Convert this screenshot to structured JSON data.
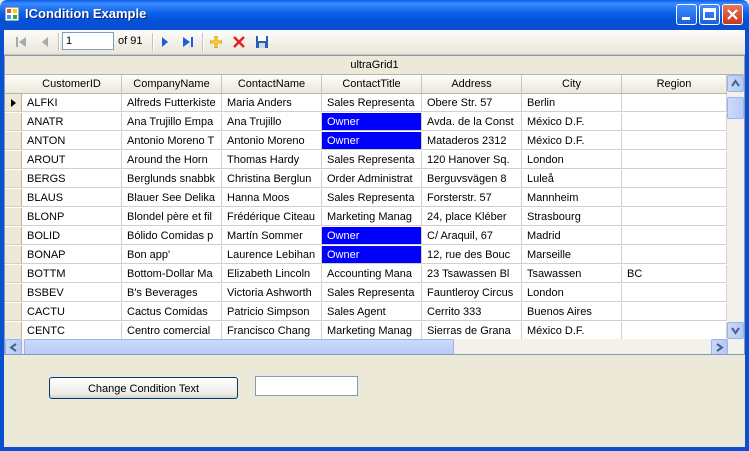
{
  "window": {
    "title": "ICondition Example"
  },
  "navigator": {
    "position": "1",
    "count_label": "of 91"
  },
  "grid": {
    "caption": "ultraGrid1",
    "columns": [
      "CustomerID",
      "CompanyName",
      "ContactName",
      "ContactTitle",
      "Address",
      "City",
      "Region"
    ],
    "rows": [
      [
        "ALFKI",
        "Alfreds Futterkiste",
        "Maria Anders",
        "Sales Representa",
        "Obere Str. 57",
        "Berlin",
        ""
      ],
      [
        "ANATR",
        "Ana Trujillo Empa",
        "Ana Trujillo",
        "Owner",
        "Avda. de la Const",
        "México D.F.",
        ""
      ],
      [
        "ANTON",
        "Antonio Moreno T",
        "Antonio Moreno",
        "Owner",
        "Mataderos  2312",
        "México D.F.",
        ""
      ],
      [
        "AROUT",
        "Around the Horn",
        "Thomas Hardy",
        "Sales Representa",
        "120 Hanover Sq.",
        "London",
        ""
      ],
      [
        "BERGS",
        "Berglunds snabbk",
        "Christina Berglun",
        "Order Administrat",
        "Berguvsvägen  8",
        "Luleå",
        ""
      ],
      [
        "BLAUS",
        "Blauer See Delika",
        "Hanna Moos",
        "Sales Representa",
        "Forsterstr. 57",
        "Mannheim",
        ""
      ],
      [
        "BLONP",
        "Blondel père et fil",
        "Frédérique Citeau",
        "Marketing Manag",
        "24, place Kléber",
        "Strasbourg",
        ""
      ],
      [
        "BOLID",
        "Bólido Comidas p",
        "Martín Sommer",
        "Owner",
        "C/ Araquil, 67",
        "Madrid",
        ""
      ],
      [
        "BONAP",
        "Bon app'",
        "Laurence Lebihan",
        "Owner",
        "12, rue des Bouc",
        "Marseille",
        ""
      ],
      [
        "BOTTM",
        "Bottom-Dollar Ma",
        "Elizabeth Lincoln",
        "Accounting Mana",
        "23 Tsawassen Bl",
        "Tsawassen",
        "BC"
      ],
      [
        "BSBEV",
        "B's Beverages",
        "Victoria Ashworth",
        "Sales Representa",
        "Fauntleroy Circus",
        "London",
        ""
      ],
      [
        "CACTU",
        "Cactus Comidas",
        "Patricio Simpson",
        "Sales Agent",
        "Cerrito 333",
        "Buenos Aires",
        ""
      ],
      [
        "CENTC",
        "Centro comercial",
        "Francisco Chang",
        "Marketing Manag",
        "Sierras de Grana",
        "México D.F.",
        ""
      ]
    ],
    "highlight_value": "Owner",
    "highlight_color": "#0000ff"
  },
  "form": {
    "change_button_label": "Change Condition Text",
    "condition_input_value": ""
  }
}
